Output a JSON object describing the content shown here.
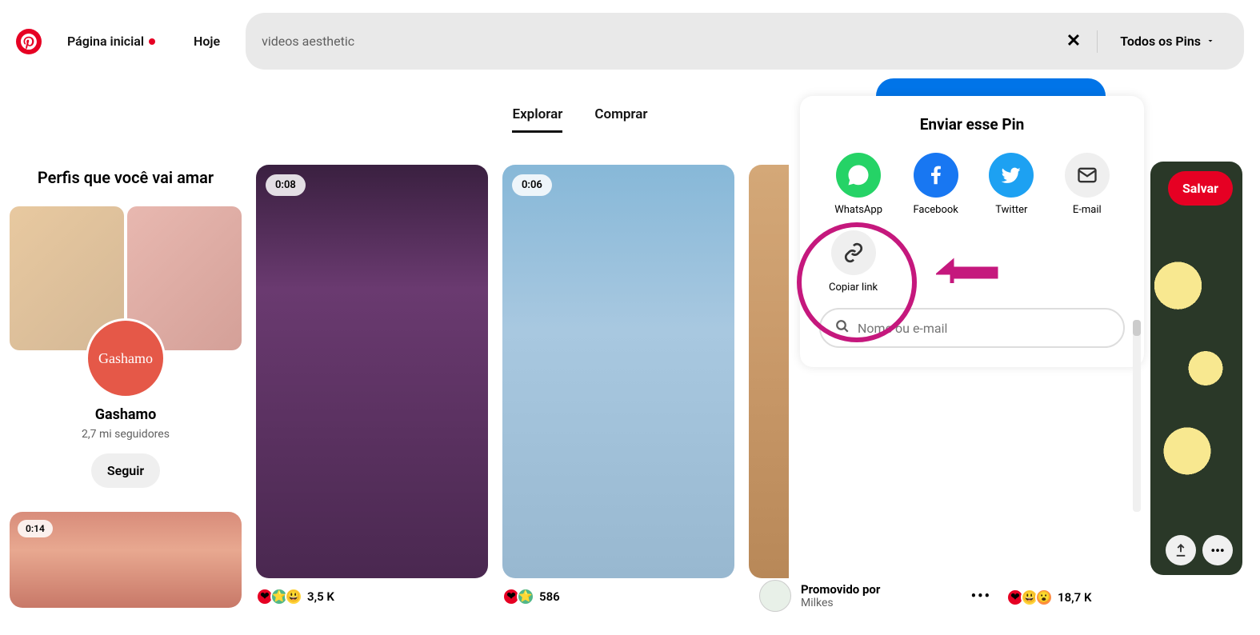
{
  "header": {
    "home": "Página inicial",
    "today": "Hoje",
    "search_value": "videos aesthetic",
    "filter": "Todos os Pins"
  },
  "tabs": {
    "explore": "Explorar",
    "buy": "Comprar"
  },
  "sidebar": {
    "title": "Perfis que você vai amar",
    "profile_name": "Gashamo",
    "profile_avatar_text": "Gashamo",
    "profile_followers": "2,7 mi seguidores",
    "follow": "Seguir",
    "mini_duration": "0:14"
  },
  "pins": [
    {
      "duration": "0:08",
      "count": "3,5 K"
    },
    {
      "duration": "0:06",
      "count": "586"
    }
  ],
  "promo": {
    "title": "Promovido por",
    "subtitle": "Milkes"
  },
  "right_stats": "18,7 K",
  "share": {
    "title": "Enviar esse Pin",
    "whatsapp": "WhatsApp",
    "facebook": "Facebook",
    "twitter": "Twitter",
    "email": "E-mail",
    "copylink": "Copiar link",
    "search_placeholder": "Nome ou e-mail"
  },
  "save": "Salvar"
}
